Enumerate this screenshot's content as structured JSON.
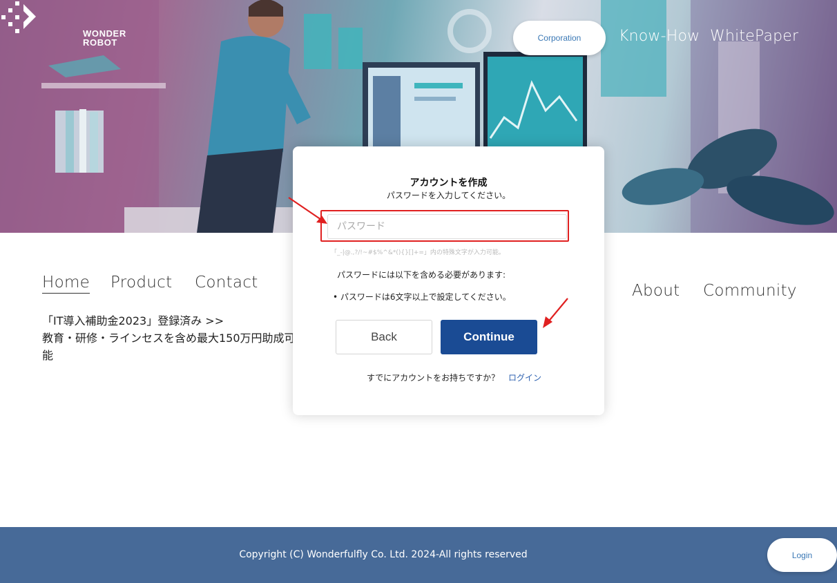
{
  "header": {
    "logo_line1": "WONDER",
    "logo_line2": "ROBOT",
    "corporation_label": "Corporation",
    "knowhow_label": "Know-How",
    "whitepaper_label": "WhitePaper"
  },
  "nav": {
    "home": "Home",
    "product": "Product",
    "contact": "Contact",
    "about": "About",
    "community": "Community"
  },
  "promo": {
    "line1": "「IT導入補助金2023」登録済み >>",
    "line2": "教育・研修・ラインセスを含め最大150万円助成可能"
  },
  "modal": {
    "title": "アカウントを作成",
    "subtitle": "パスワードを入力してください。",
    "password_placeholder": "パスワード",
    "hint": "「_-|@.,?/!~#$%^&*(){}[]+=」内の特殊文字が入力可能。",
    "requirements_heading": "パスワードには以下を含める必要があります:",
    "requirement_1": "• パスワードは6文字以上で設定してください。",
    "back_label": "Back",
    "continue_label": "Continue",
    "already_text": "すでにアカウントをお持ちですか？",
    "login_link": "ログイン"
  },
  "footer": {
    "copyright": "Copyright (C) Wonderfulfly Co. Ltd. 2024-All rights reserved",
    "login_label": "Login"
  },
  "colors": {
    "primary_button": "#1a4b94",
    "footer_bg": "#476a98",
    "highlight": "#e02020",
    "link": "#2f62b0"
  }
}
